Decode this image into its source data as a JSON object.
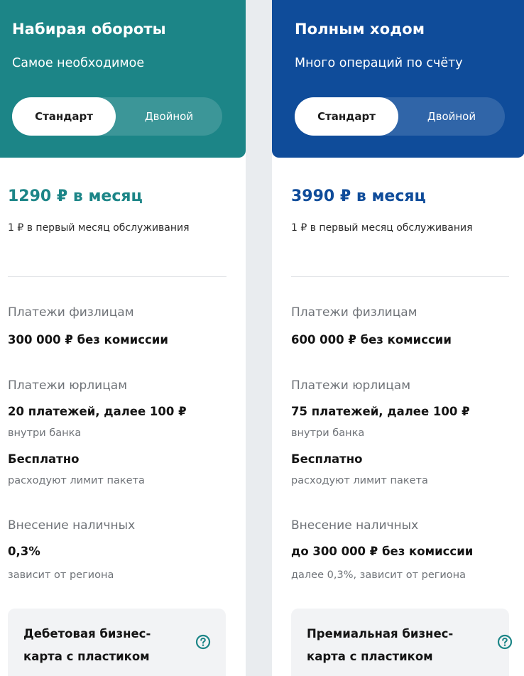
{
  "plans": [
    {
      "title": "Набирая обороты",
      "subtitle": "Самое необходимое",
      "toggle": {
        "active": "Стандарт",
        "inactive": "Двойной"
      },
      "price": "1290 ₽ в месяц",
      "price_note": "1 ₽ в первый месяц обслуживания",
      "individuals_label": "Платежи физлицам",
      "individuals_value": "300 000 ₽ без комиссии",
      "legal_label": "Платежи юрлицам",
      "legal_value": "20 платежей, далее 100 ₽",
      "legal_note": "внутри банка",
      "free_value": "Бесплатно",
      "free_note": "расходуют лимит пакета",
      "cash_label": "Внесение наличных",
      "cash_value": "0,3%",
      "cash_note": "зависит от региона",
      "card_line1": "Дебетовая бизнес-",
      "card_line2": "карта с пластиком",
      "accent": "#1c8587"
    },
    {
      "title": "Полным ходом",
      "subtitle": "Много операций по счёту",
      "toggle": {
        "active": "Стандарт",
        "inactive": "Двойной"
      },
      "price": "3990 ₽ в месяц",
      "price_note": "1 ₽ в первый месяц обслуживания",
      "individuals_label": "Платежи физлицам",
      "individuals_value": "600 000 ₽ без комиссии",
      "legal_label": "Платежи юрлицам",
      "legal_value": "75 платежей, далее 100 ₽",
      "legal_note": "внутри банка",
      "free_value": "Бесплатно",
      "free_note": "расходуют лимит пакета",
      "cash_label": "Внесение наличных",
      "cash_value": "до 300 000 ₽ без комиссии",
      "cash_note": "далее 0,3%, зависит от региона",
      "card_line1": "Премиальная бизнес-",
      "card_line2": "карта с пластиком",
      "accent": "#0f4c9a"
    }
  ],
  "icons": {
    "help": "question-circle-icon"
  }
}
